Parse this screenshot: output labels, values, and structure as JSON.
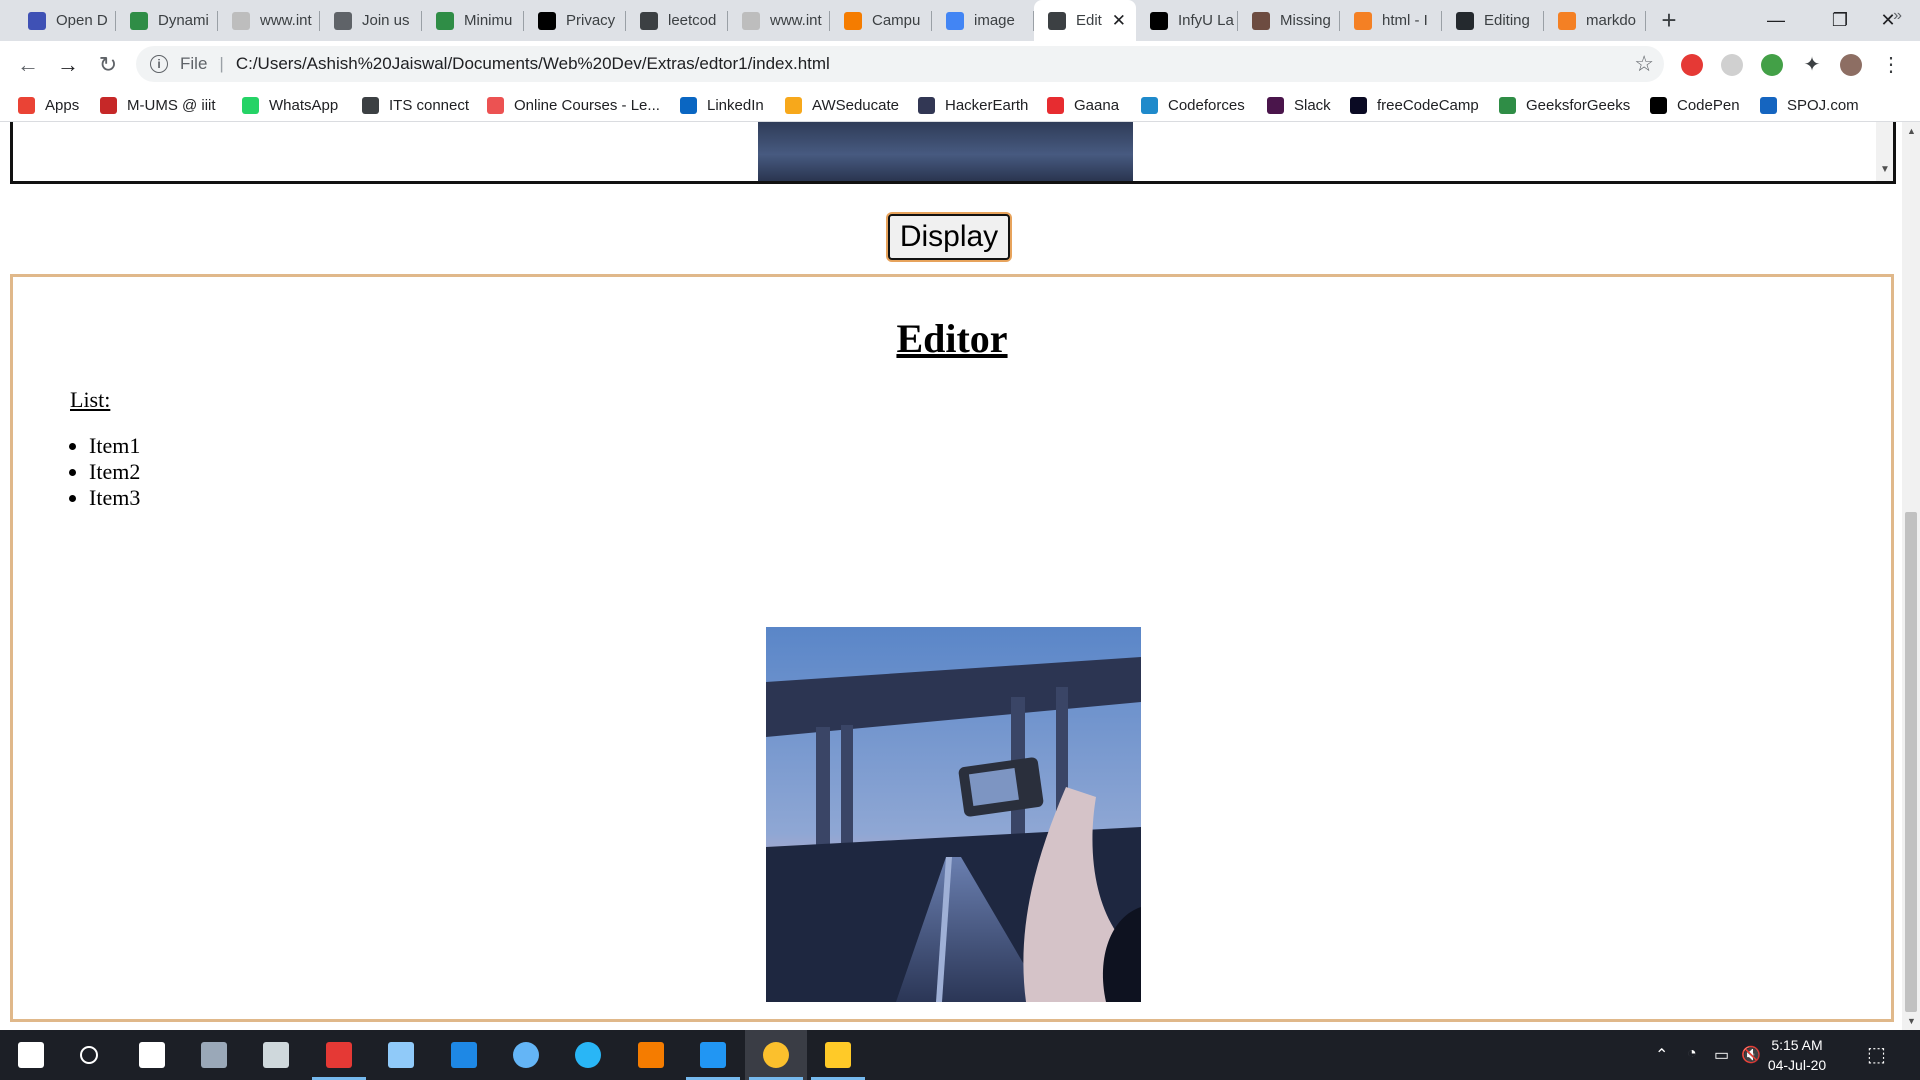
{
  "browser": {
    "tabs": [
      {
        "label": "Open D",
        "icon": "blue-shield-icon",
        "color": "#3f51b5"
      },
      {
        "label": "Dynami",
        "icon": "geeksforgeeks-icon",
        "color": "#2f8d46"
      },
      {
        "label": "www.int",
        "icon": "blank-page-icon",
        "color": "#bdbdbd"
      },
      {
        "label": "Join us",
        "icon": "power-icon",
        "color": "#5f6368"
      },
      {
        "label": "Minimu",
        "icon": "geeksforgeeks-icon",
        "color": "#2f8d46"
      },
      {
        "label": "Privacy",
        "icon": "a-letter-icon",
        "color": "#000000"
      },
      {
        "label": "leetcod",
        "icon": "leetcode-icon",
        "color": "#3c4043"
      },
      {
        "label": "www.int",
        "icon": "blank-page-icon",
        "color": "#bdbdbd"
      },
      {
        "label": "Campu",
        "icon": "campus-icon",
        "color": "#f57c00"
      },
      {
        "label": "image",
        "icon": "google-icon",
        "color": "#4285f4"
      },
      {
        "label": "Edit",
        "icon": "globe-icon",
        "color": "#3c4043",
        "active": true
      },
      {
        "label": "InfyU La",
        "icon": "infinity-icon",
        "color": "#000000"
      },
      {
        "label": "Missing",
        "icon": "cc-icon",
        "color": "#6d4c41"
      },
      {
        "label": "html - I",
        "icon": "stackoverflow-icon",
        "color": "#f48024"
      },
      {
        "label": "Editing",
        "icon": "github-icon",
        "color": "#24292e"
      },
      {
        "label": "markdo",
        "icon": "stackoverflow-icon",
        "color": "#f48024"
      }
    ],
    "new_tab_glyph": "+",
    "address": {
      "scheme": "File",
      "url": "C:/Users/Ashish%20Jaiswal/Documents/Web%20Dev/Extras/edtor1/index.html"
    },
    "bookmarks": [
      {
        "label": "Apps",
        "icon": "apps-grid-icon",
        "color": "#ea4335"
      },
      {
        "label": "M-UMS @ iiit",
        "icon": "raspberry-icon",
        "color": "#c62828"
      },
      {
        "label": "WhatsApp",
        "icon": "whatsapp-icon",
        "color": "#25d366"
      },
      {
        "label": "ITS connect",
        "icon": "globe-icon",
        "color": "#3c4043"
      },
      {
        "label": "Online Courses - Le...",
        "icon": "udemy-icon",
        "color": "#ec5252"
      },
      {
        "label": "LinkedIn",
        "icon": "linkedin-icon",
        "color": "#0a66c2"
      },
      {
        "label": "AWSeducate",
        "icon": "aws-icon",
        "color": "#f7a81b"
      },
      {
        "label": "HackerEarth",
        "icon": "hackerearth-icon",
        "color": "#323754"
      },
      {
        "label": "Gaana",
        "icon": "gaana-icon",
        "color": "#e72c30"
      },
      {
        "label": "Codeforces",
        "icon": "codeforces-icon",
        "color": "#1f8acb"
      },
      {
        "label": "Slack",
        "icon": "slack-icon",
        "color": "#4a154b"
      },
      {
        "label": "freeCodeCamp",
        "icon": "freecodecamp-icon",
        "color": "#0a0a23"
      },
      {
        "label": "GeeksforGeeks",
        "icon": "geeksforgeeks-icon",
        "color": "#2f8d46"
      },
      {
        "label": "CodePen",
        "icon": "codepen-icon",
        "color": "#000000"
      },
      {
        "label": "SPOJ.com",
        "icon": "spoj-icon",
        "color": "#1565c0"
      }
    ],
    "bookmarks_overflow": "»"
  },
  "page": {
    "display_button_label": "Display",
    "editor_heading": "Editor",
    "list_label": "List:",
    "list_items": [
      "Item1",
      "Item2",
      "Item3"
    ]
  },
  "taskbar": {
    "apps": [
      {
        "name": "start-icon"
      },
      {
        "name": "search-icon"
      },
      {
        "name": "store-icon"
      },
      {
        "name": "mysql-workbench-icon"
      },
      {
        "name": "terminal-icon"
      },
      {
        "name": "office-icon"
      },
      {
        "name": "virtualbox-icon"
      },
      {
        "name": "edge-icon"
      },
      {
        "name": "info-icon"
      },
      {
        "name": "telegram-icon"
      },
      {
        "name": "git-icon"
      },
      {
        "name": "vscode-icon"
      },
      {
        "name": "chrome-icon"
      },
      {
        "name": "file-explorer-icon"
      }
    ],
    "time": "5:15 AM",
    "date": "04-Jul-20"
  }
}
